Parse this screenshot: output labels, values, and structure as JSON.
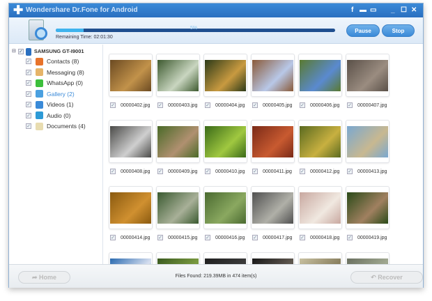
{
  "app": {
    "title": "Wondershare Dr.Fone for Android",
    "icons": [
      "facebook-icon",
      "feedback-icon",
      "register-icon"
    ],
    "controls": [
      "minimize",
      "maximize",
      "close"
    ]
  },
  "scan": {
    "progress_percent": 10,
    "progress_text": "5%",
    "remaining": "Remaining Time: 02:01:30",
    "pause": "Pause",
    "stop": "Stop"
  },
  "sidebar": {
    "device": "SAMSUNG GT-I9001",
    "items": [
      {
        "label": "Contacts (8)",
        "color": "#e8732a"
      },
      {
        "label": "Messaging (8)",
        "color": "#e6b469"
      },
      {
        "label": "WhatsApp (0)",
        "color": "#3cbf3c"
      },
      {
        "label": "Gallery (2)",
        "color": "#4aa0e0",
        "selected": true
      },
      {
        "label": "Videos (1)",
        "color": "#3a8ad8"
      },
      {
        "label": "Audio (0)",
        "color": "#2d9ad6"
      },
      {
        "label": "Documents (4)",
        "color": "#e8dcb0"
      }
    ]
  },
  "files": [
    {
      "name": "00000402.jpg",
      "colors": [
        "#6b4a22",
        "#c2924a"
      ]
    },
    {
      "name": "00000403.jpg",
      "colors": [
        "#3e5a30",
        "#c9d6c0"
      ]
    },
    {
      "name": "00000404.jpg",
      "colors": [
        "#2c3a18",
        "#c89a40"
      ]
    },
    {
      "name": "00000405.jpg",
      "colors": [
        "#8a5a38",
        "#b8c8e8"
      ]
    },
    {
      "name": "00000406.jpg",
      "colors": [
        "#5a7a30",
        "#5a8ad0"
      ]
    },
    {
      "name": "00000407.jpg",
      "colors": [
        "#5a5048",
        "#9a8c80"
      ]
    },
    {
      "name": "00000408.jpg",
      "colors": [
        "#4a4a48",
        "#cfcfcf"
      ]
    },
    {
      "name": "00000409.jpg",
      "colors": [
        "#4a6a28",
        "#b09070"
      ]
    },
    {
      "name": "00000410.jpg",
      "colors": [
        "#3a6a18",
        "#a0c840"
      ]
    },
    {
      "name": "00000411.jpg",
      "colors": [
        "#7a2a18",
        "#c85a30"
      ]
    },
    {
      "name": "00000412.jpg",
      "colors": [
        "#5a6a20",
        "#c8b040"
      ]
    },
    {
      "name": "00000413.jpg",
      "colors": [
        "#7aa8d0",
        "#c8b890"
      ]
    },
    {
      "name": "00000414.jpg",
      "colors": [
        "#8a5a10",
        "#d09030"
      ]
    },
    {
      "name": "00000415.jpg",
      "colors": [
        "#3a5a30",
        "#a8b098"
      ]
    },
    {
      "name": "00000416.jpg",
      "colors": [
        "#4a6a30",
        "#8aa860"
      ]
    },
    {
      "name": "00000417.jpg",
      "colors": [
        "#505050",
        "#b0b0a8"
      ]
    },
    {
      "name": "00000418.jpg",
      "colors": [
        "#c8a8a0",
        "#f0e8e0"
      ]
    },
    {
      "name": "00000419.jpg",
      "colors": [
        "#2a4a18",
        "#a08060"
      ]
    },
    {
      "name": "",
      "colors": [
        "#2a6ab0",
        "#d8e0f0"
      ]
    },
    {
      "name": "",
      "colors": [
        "#3a5a20",
        "#7a9a40"
      ]
    },
    {
      "name": "",
      "colors": [
        "#202020",
        "#3a3a3a"
      ]
    },
    {
      "name": "",
      "colors": [
        "#181818",
        "#605850"
      ]
    },
    {
      "name": "",
      "colors": [
        "#c8c0a0",
        "#8a8060"
      ]
    },
    {
      "name": "",
      "colors": [
        "#6a7060",
        "#a0a890"
      ]
    }
  ],
  "footer": {
    "home": "Home",
    "found": "Files Found: 219.39MB in 474 item(s)",
    "recover": "Recover"
  }
}
